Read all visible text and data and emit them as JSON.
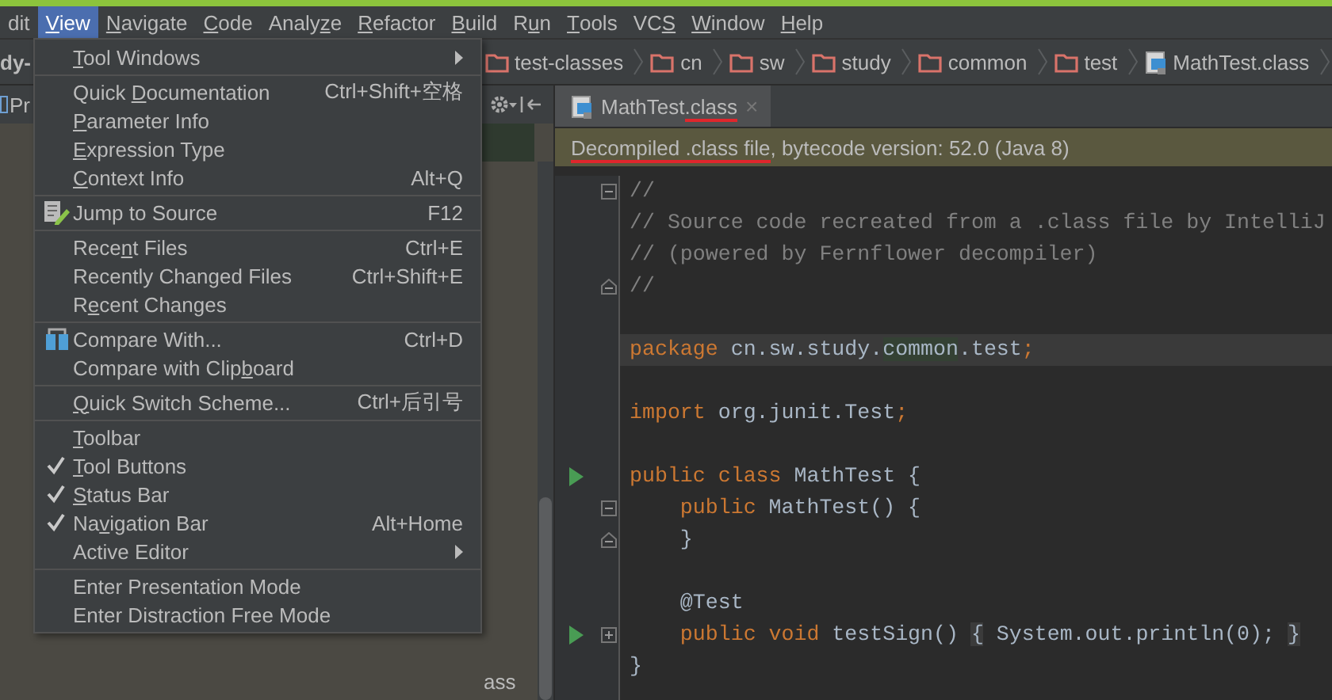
{
  "menubar": [
    {
      "parts": [
        {
          "text": "dit",
          "underlined": false
        }
      ],
      "selected": false
    },
    {
      "parts": [
        {
          "text": "V",
          "underlined": true
        },
        {
          "text": "iew",
          "underlined": false
        }
      ],
      "selected": true
    },
    {
      "parts": [
        {
          "text": "N",
          "underlined": true
        },
        {
          "text": "avigate",
          "underlined": false
        }
      ],
      "selected": false
    },
    {
      "parts": [
        {
          "text": "C",
          "underlined": true
        },
        {
          "text": "ode",
          "underlined": false
        }
      ],
      "selected": false
    },
    {
      "parts": [
        {
          "text": "Analy",
          "underlined": false
        },
        {
          "text": "z",
          "underlined": true
        },
        {
          "text": "e",
          "underlined": false
        }
      ],
      "selected": false
    },
    {
      "parts": [
        {
          "text": "R",
          "underlined": true
        },
        {
          "text": "efactor",
          "underlined": false
        }
      ],
      "selected": false
    },
    {
      "parts": [
        {
          "text": "B",
          "underlined": true
        },
        {
          "text": "uild",
          "underlined": false
        }
      ],
      "selected": false
    },
    {
      "parts": [
        {
          "text": "R",
          "underlined": false
        },
        {
          "text": "u",
          "underlined": true
        },
        {
          "text": "n",
          "underlined": false
        }
      ],
      "selected": false
    },
    {
      "parts": [
        {
          "text": "T",
          "underlined": true
        },
        {
          "text": "ools",
          "underlined": false
        }
      ],
      "selected": false
    },
    {
      "parts": [
        {
          "text": "VC",
          "underlined": false
        },
        {
          "text": "S",
          "underlined": true
        }
      ],
      "selected": false
    },
    {
      "parts": [
        {
          "text": "W",
          "underlined": true
        },
        {
          "text": "indow",
          "underlined": false
        }
      ],
      "selected": false
    },
    {
      "parts": [
        {
          "text": "H",
          "underlined": true
        },
        {
          "text": "elp",
          "underlined": false
        }
      ],
      "selected": false
    }
  ],
  "navbar": {
    "project": "dy-",
    "crumbs": [
      {
        "label": "test-classes",
        "kind": "folder"
      },
      {
        "label": "cn",
        "kind": "folder"
      },
      {
        "label": "sw",
        "kind": "folder"
      },
      {
        "label": "study",
        "kind": "folder"
      },
      {
        "label": "common",
        "kind": "folder"
      },
      {
        "label": "test",
        "kind": "folder"
      },
      {
        "label": "MathTest.class",
        "kind": "class"
      }
    ]
  },
  "project_panel": {
    "title": "Pr",
    "row_text": "ass"
  },
  "view_menu": [
    {
      "kind": "submenu",
      "parts": [
        {
          "text": "T",
          "underlined": true
        },
        {
          "text": "ool Windows",
          "underlined": false
        }
      ]
    },
    {
      "kind": "separator"
    },
    {
      "kind": "action",
      "parts": [
        {
          "text": "Quick ",
          "underlined": false
        },
        {
          "text": "D",
          "underlined": true
        },
        {
          "text": "ocumentation",
          "underlined": false
        }
      ],
      "shortcut": "Ctrl+Shift+空格"
    },
    {
      "kind": "action",
      "parts": [
        {
          "text": "P",
          "underlined": true
        },
        {
          "text": "arameter Info",
          "underlined": false
        }
      ]
    },
    {
      "kind": "action",
      "parts": [
        {
          "text": "E",
          "underlined": true
        },
        {
          "text": "xpression Type",
          "underlined": false
        }
      ]
    },
    {
      "kind": "action",
      "parts": [
        {
          "text": "C",
          "underlined": true
        },
        {
          "text": "ontext Info",
          "underlined": false
        }
      ],
      "shortcut": "Alt+Q"
    },
    {
      "kind": "separator"
    },
    {
      "kind": "source-action",
      "parts": [
        {
          "text": "Jump to Source",
          "underlined": false
        }
      ],
      "shortcut": "F12"
    },
    {
      "kind": "separator"
    },
    {
      "kind": "action",
      "parts": [
        {
          "text": "Rece",
          "underlined": false
        },
        {
          "text": "n",
          "underlined": true
        },
        {
          "text": "t Files",
          "underlined": false
        }
      ],
      "shortcut": "Ctrl+E"
    },
    {
      "kind": "action",
      "parts": [
        {
          "text": "Recently Changed Files",
          "underlined": false
        }
      ],
      "shortcut": "Ctrl+Shift+E"
    },
    {
      "kind": "action",
      "parts": [
        {
          "text": "R",
          "underlined": false
        },
        {
          "text": "e",
          "underlined": true
        },
        {
          "text": "cent Changes",
          "underlined": false
        }
      ]
    },
    {
      "kind": "separator"
    },
    {
      "kind": "diff-action",
      "parts": [
        {
          "text": "Compare With...",
          "underlined": false
        }
      ],
      "shortcut": "Ctrl+D"
    },
    {
      "kind": "action",
      "parts": [
        {
          "text": "Compare with Clip",
          "underlined": false
        },
        {
          "text": "b",
          "underlined": true
        },
        {
          "text": "oard",
          "underlined": false
        }
      ]
    },
    {
      "kind": "separator"
    },
    {
      "kind": "action",
      "parts": [
        {
          "text": "Q",
          "underlined": true
        },
        {
          "text": "uick Switch Scheme...",
          "underlined": false
        }
      ],
      "shortcut": "Ctrl+后引号"
    },
    {
      "kind": "separator"
    },
    {
      "kind": "toggle",
      "parts": [
        {
          "text": "T",
          "underlined": true
        },
        {
          "text": "oolbar",
          "underlined": false
        }
      ],
      "checked": false
    },
    {
      "kind": "toggle",
      "parts": [
        {
          "text": "T",
          "underlined": true
        },
        {
          "text": "ool Buttons",
          "underlined": false
        }
      ],
      "checked": true
    },
    {
      "kind": "toggle",
      "parts": [
        {
          "text": "S",
          "underlined": true
        },
        {
          "text": "tatus Bar",
          "underlined": false
        }
      ],
      "checked": true
    },
    {
      "kind": "toggle",
      "parts": [
        {
          "text": "Na",
          "underlined": false
        },
        {
          "text": "v",
          "underlined": true
        },
        {
          "text": "igation Bar",
          "underlined": false
        }
      ],
      "checked": true,
      "shortcut": "Alt+Home"
    },
    {
      "kind": "submenu",
      "parts": [
        {
          "text": "Active Editor",
          "underlined": false
        }
      ]
    },
    {
      "kind": "separator"
    },
    {
      "kind": "action",
      "parts": [
        {
          "text": "Enter Presentation Mode",
          "underlined": false
        }
      ]
    },
    {
      "kind": "action",
      "parts": [
        {
          "text": "Enter Distraction Free Mode",
          "underlined": false
        }
      ]
    }
  ],
  "editor": {
    "tab": {
      "parts": [
        {
          "text": "MathTest",
          "underlined": false
        },
        {
          "text": ".class",
          "underlined": true
        }
      ],
      "close": "×",
      "selected": true
    },
    "notice": {
      "parts": [
        {
          "text": "Decompiled .class file",
          "underlined": true
        },
        {
          "text": ", bytecode version: 52.0 (Java 8)",
          "underlined": false
        }
      ]
    },
    "lines": [
      {
        "kind": "code",
        "current": false,
        "markers": [
          {
            "kind": "fold-start"
          }
        ],
        "tokens": [
          {
            "kind": "comment",
            "s": "//"
          }
        ]
      },
      {
        "kind": "code",
        "current": false,
        "tokens": [
          {
            "kind": "comment",
            "s": "// Source code recreated from a .class file by IntelliJ"
          }
        ]
      },
      {
        "kind": "code",
        "current": false,
        "tokens": [
          {
            "kind": "comment",
            "s": "// (powered by Fernflower decompiler)"
          }
        ]
      },
      {
        "kind": "code",
        "current": false,
        "markers": [
          {
            "kind": "fold-end"
          }
        ],
        "tokens": [
          {
            "kind": "comment",
            "s": "//"
          }
        ]
      },
      {
        "kind": "blank",
        "current": false
      },
      {
        "kind": "code",
        "current": true,
        "tokens": [
          {
            "kind": "keyword",
            "s": "package"
          },
          {
            "kind": "plain",
            "s": " cn.sw.study."
          },
          {
            "kind": "match",
            "s": "common"
          },
          {
            "kind": "plain",
            "s": ".test"
          },
          {
            "kind": "keyword",
            "s": ";"
          }
        ]
      },
      {
        "kind": "blank",
        "current": false
      },
      {
        "kind": "code",
        "current": false,
        "tokens": [
          {
            "kind": "keyword",
            "s": "import"
          },
          {
            "kind": "plain",
            "s": " org.junit.Test"
          },
          {
            "kind": "keyword",
            "s": ";"
          }
        ]
      },
      {
        "kind": "blank",
        "current": false
      },
      {
        "kind": "code",
        "current": false,
        "markers": [
          {
            "kind": "run"
          }
        ],
        "tokens": [
          {
            "kind": "keyword",
            "s": "public class"
          },
          {
            "kind": "plain",
            "s": " MathTest {"
          }
        ]
      },
      {
        "kind": "code",
        "current": false,
        "markers": [
          {
            "kind": "fold-start"
          }
        ],
        "tokens": [
          {
            "kind": "keyword",
            "s": "    public"
          },
          {
            "kind": "plain",
            "s": " MathTest() {"
          }
        ]
      },
      {
        "kind": "code",
        "current": false,
        "markers": [
          {
            "kind": "fold-end"
          }
        ],
        "tokens": [
          {
            "kind": "plain",
            "s": "    }"
          }
        ]
      },
      {
        "kind": "blank",
        "current": false
      },
      {
        "kind": "code",
        "current": false,
        "tokens": [
          {
            "kind": "plain",
            "s": "    @Test"
          }
        ]
      },
      {
        "kind": "code",
        "current": false,
        "markers": [
          {
            "kind": "run"
          },
          {
            "kind": "fold-collapsed"
          }
        ],
        "tokens": [
          {
            "kind": "keyword",
            "s": "    public void"
          },
          {
            "kind": "plain",
            "s": " testSign() "
          },
          {
            "kind": "folded",
            "s": "{"
          },
          {
            "kind": "plain",
            "s": " System.out.println(0); "
          },
          {
            "kind": "folded",
            "s": "}"
          }
        ]
      },
      {
        "kind": "code",
        "current": false,
        "tokens": [
          {
            "kind": "plain",
            "s": "}"
          }
        ]
      }
    ]
  }
}
